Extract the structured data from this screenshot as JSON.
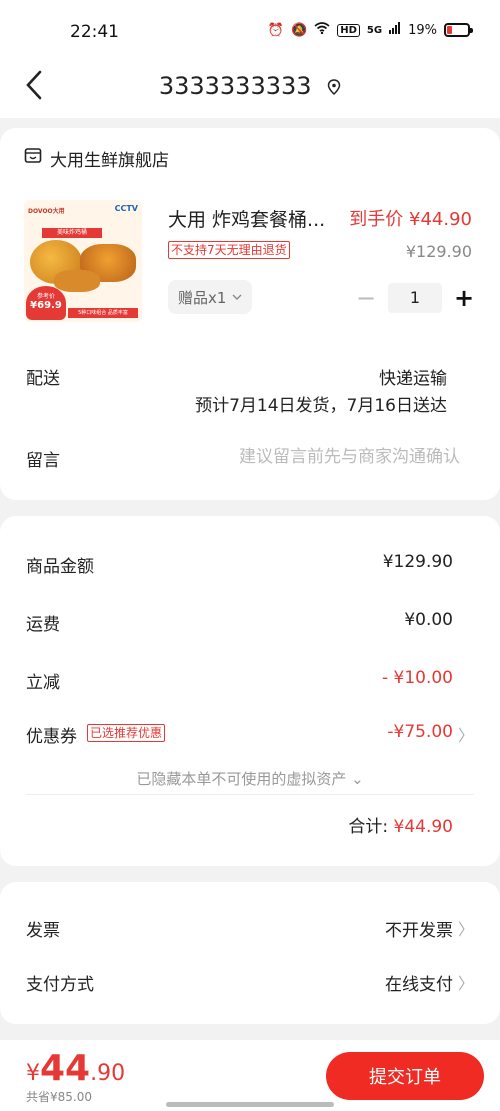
{
  "status": {
    "time": "22:41",
    "signal": "5G",
    "battery": "19%",
    "hd": "HD"
  },
  "nav": {
    "title": "3333333333"
  },
  "shop": {
    "name": "大用生鲜旗舰店"
  },
  "product": {
    "title": "大用 炸鸡套餐桶...",
    "final_price": "到手价 ¥44.90",
    "no_return": "不支持7天无理由退货",
    "original_price": "¥129.90",
    "gift": "赠品x1",
    "quantity": "1",
    "image": {
      "brand": "DOVOO大用",
      "cctv": "CCTV",
      "ribbon": "美味炸鸡桶",
      "tag_label": "参考价",
      "tag_price": "¥69.9",
      "bottom_text": "5种口味组合 品质丰富"
    }
  },
  "shipping": {
    "label": "配送",
    "method": "快递运输",
    "estimate": "预计7月14日发货，7月16日送达"
  },
  "message": {
    "label": "留言",
    "placeholder": "建议留言前先与商家沟通确认"
  },
  "summary": {
    "goods_label": "商品金额",
    "goods_value": "¥129.90",
    "freight_label": "运费",
    "freight_value": "¥0.00",
    "discount_label": "立减",
    "discount_value": "- ¥10.00",
    "coupon_label": "优惠券",
    "coupon_tag": "已选推荐优惠",
    "coupon_value": "-¥75.00",
    "hidden_assets": "已隐藏本单不可使用的虚拟资产 ⌄",
    "total_label": "合计:",
    "total_value": "¥44.90"
  },
  "invoice": {
    "label": "发票",
    "value": "不开发票"
  },
  "payment": {
    "label": "支付方式",
    "value": "在线支付"
  },
  "bottom": {
    "yen": "¥",
    "int": "44",
    "dec": ".90",
    "saved": "共省¥85.00",
    "submit": "提交订单"
  },
  "colors": {
    "accent": "#e53935",
    "button": "#f02b23"
  }
}
